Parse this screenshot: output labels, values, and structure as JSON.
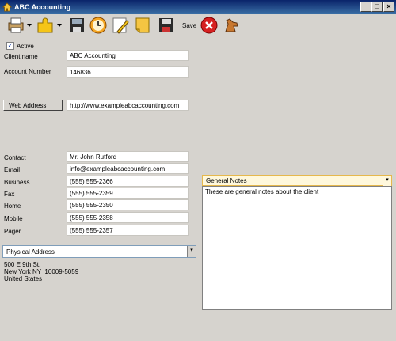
{
  "window": {
    "title": "ABC Accounting",
    "controls": [
      "_",
      "□",
      "×"
    ]
  },
  "toolbar": {
    "save_label": "Save",
    "icons": [
      "printer-icon",
      "puzzle-icon",
      "floppy-disk-icon",
      "clock-icon",
      "edit-pencil-icon",
      "sticky-note-icon",
      "save-disk-icon",
      "close-icon",
      "horse-icon"
    ]
  },
  "client": {
    "active_label": "Active",
    "active_checked": true,
    "client_name_label": "Client name",
    "client_name": "ABC Accounting",
    "account_number_label": "Account Number",
    "account_number": "146836",
    "web_address_button": "Web Address",
    "web_address": "http://www.exampleabcaccounting.com"
  },
  "contact": {
    "contact_label": "Contact",
    "contact": "Mr. John Rutford",
    "email_label": "Email",
    "email": "info@exampleabcaccounting.com",
    "business_label": "Business",
    "business": "(555) 555-2366",
    "fax_label": "Fax",
    "fax": "(555) 555-2359",
    "home_label": "Home",
    "home": "(555) 555-2350",
    "mobile_label": "Mobile",
    "mobile": "(555) 555-2358",
    "pager_label": "Pager",
    "pager": "(555) 555-2357"
  },
  "address": {
    "selector": "Physical Address",
    "line1": "500 E 9th St,",
    "line2": "New York NY  10009-5059",
    "line3": "United States"
  },
  "notes": {
    "selector": "General Notes",
    "text": "These are general notes about the client"
  }
}
